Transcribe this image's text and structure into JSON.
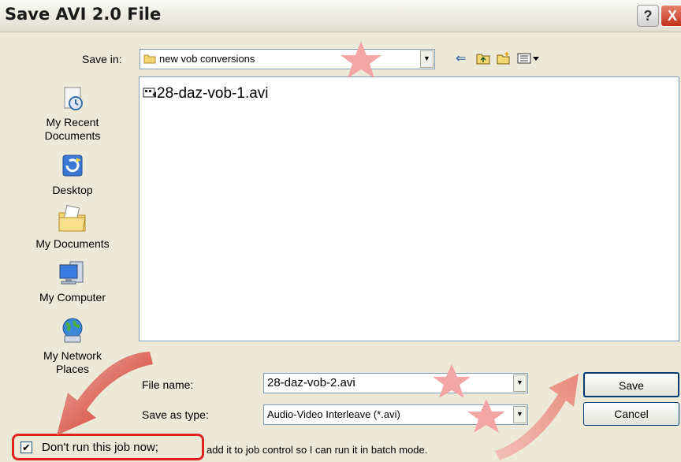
{
  "window": {
    "title": "Save AVI 2.0 File",
    "help_glyph": "?",
    "close_glyph": "X"
  },
  "save_in": {
    "label": "Save in:",
    "value": "new vob conversions",
    "folder_icon": "folder-icon"
  },
  "toolbar_icons": [
    "back-arrow-icon",
    "up-folder-icon",
    "new-folder-icon",
    "view-menu-icon"
  ],
  "file_list": {
    "items": [
      {
        "name": "28-daz-vob-1.avi",
        "icon": "video-file-icon"
      }
    ]
  },
  "places_bar": [
    {
      "label": "My Recent Documents",
      "lines": [
        "My Recent",
        "Documents"
      ],
      "icon": "recent-documents-icon"
    },
    {
      "label": "Desktop",
      "lines": [
        "Desktop"
      ],
      "icon": "desktop-icon"
    },
    {
      "label": "My Documents",
      "lines": [
        "My Documents"
      ],
      "icon": "my-documents-icon"
    },
    {
      "label": "My Computer",
      "lines": [
        "My Computer"
      ],
      "icon": "my-computer-icon"
    },
    {
      "label": "My Network Places",
      "lines": [
        "My Network",
        "Places"
      ],
      "icon": "network-places-icon"
    }
  ],
  "file_name": {
    "label": "File name:",
    "value": "28-daz-vob-2.avi"
  },
  "save_as_type": {
    "label": "Save as type:",
    "value": "Audio-Video Interleave (*.avi)"
  },
  "buttons": {
    "save": "Save",
    "cancel": "Cancel"
  },
  "option": {
    "checked": true,
    "label_main": "Don't run this job now;",
    "label_rest": "add it to job control so I can run it in batch mode."
  },
  "annotation_colors": {
    "star": "#f4a6a6",
    "highlight": "#e0241f"
  }
}
